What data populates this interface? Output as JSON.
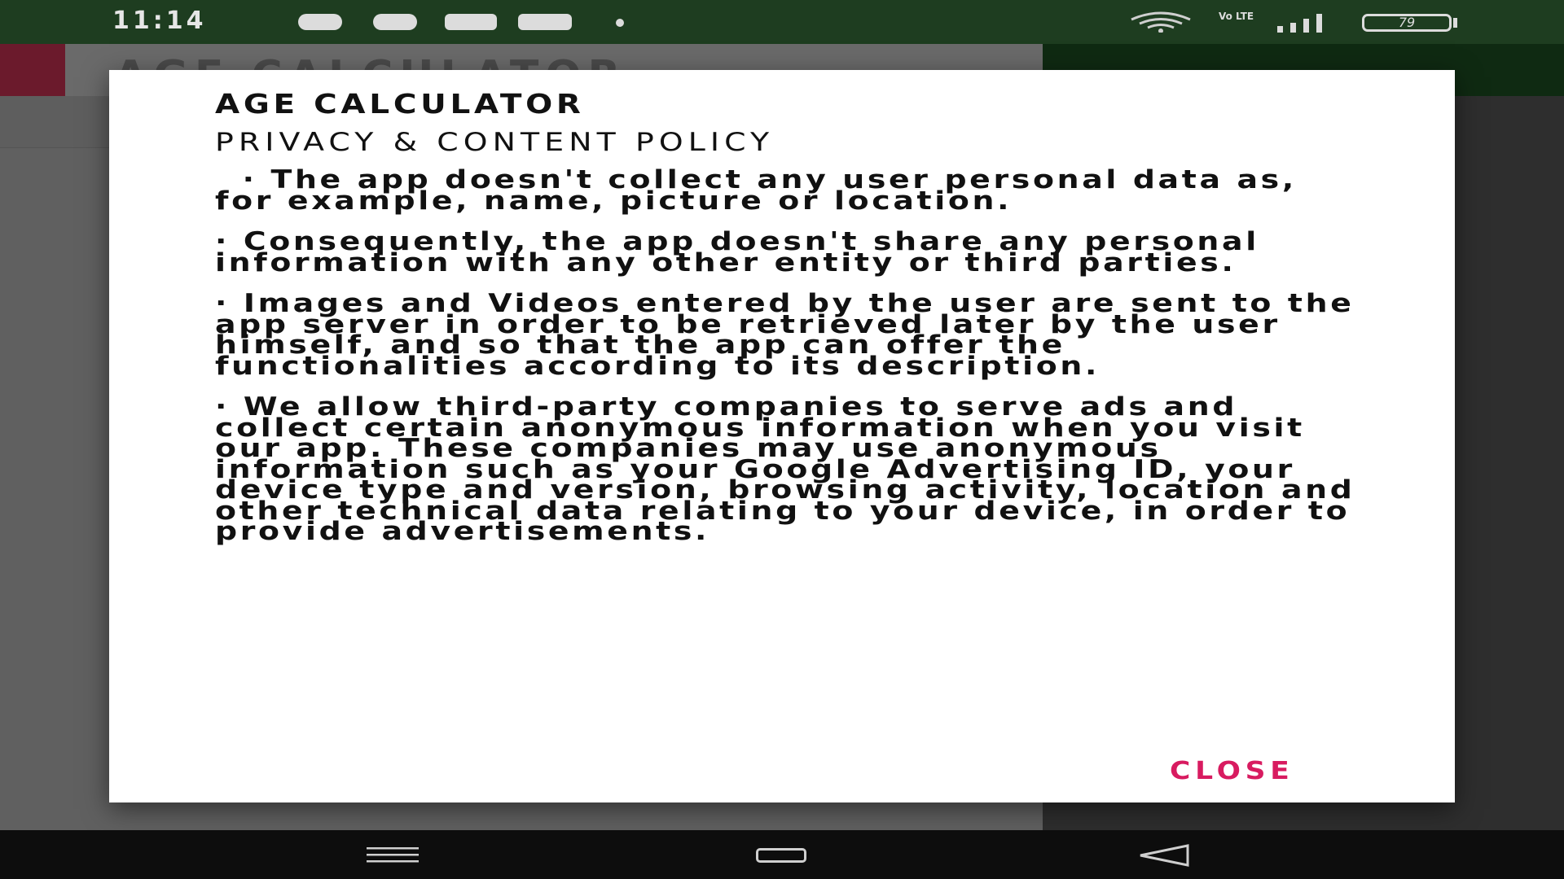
{
  "status_bar": {
    "time": "11:14",
    "notification_icons": [
      "facebook-icon",
      "facebook-icon",
      "youtube-icon",
      "youtube-icon",
      "dot-icon"
    ],
    "network_label": "Vo LTE",
    "battery_level": "79",
    "bar_color": "#1e3d20"
  },
  "background_app": {
    "title": "AGE CALCULATOR",
    "accent_color": "#6b1a2c"
  },
  "dialog": {
    "title": "AGE CALCULATOR",
    "heading": "PRIVACY & CONTENT POLICY",
    "paragraphs": [
      "  · The app doesn't collect any user personal data as, for example, name, picture or location.",
      "· Consequently, the app doesn't share any personal information with any other entity or third parties.",
      "· Images and Videos entered by the user are sent to the app server in order to be retrieved later by the user himself, and so that the app can offer the functionalities according to its description.",
      "· We allow third-party companies to serve ads and collect certain anonymous information when you visit our app. These companies may use anonymous information such as your Google Advertising ID, your device type and version, browsing activity, location and other technical data relating to your device, in order to provide advertisements."
    ],
    "close_label": "CLOSE",
    "close_color": "#d81b60"
  },
  "nav_bar": {
    "icons": [
      "menu-icon",
      "home-icon",
      "back-icon"
    ]
  }
}
